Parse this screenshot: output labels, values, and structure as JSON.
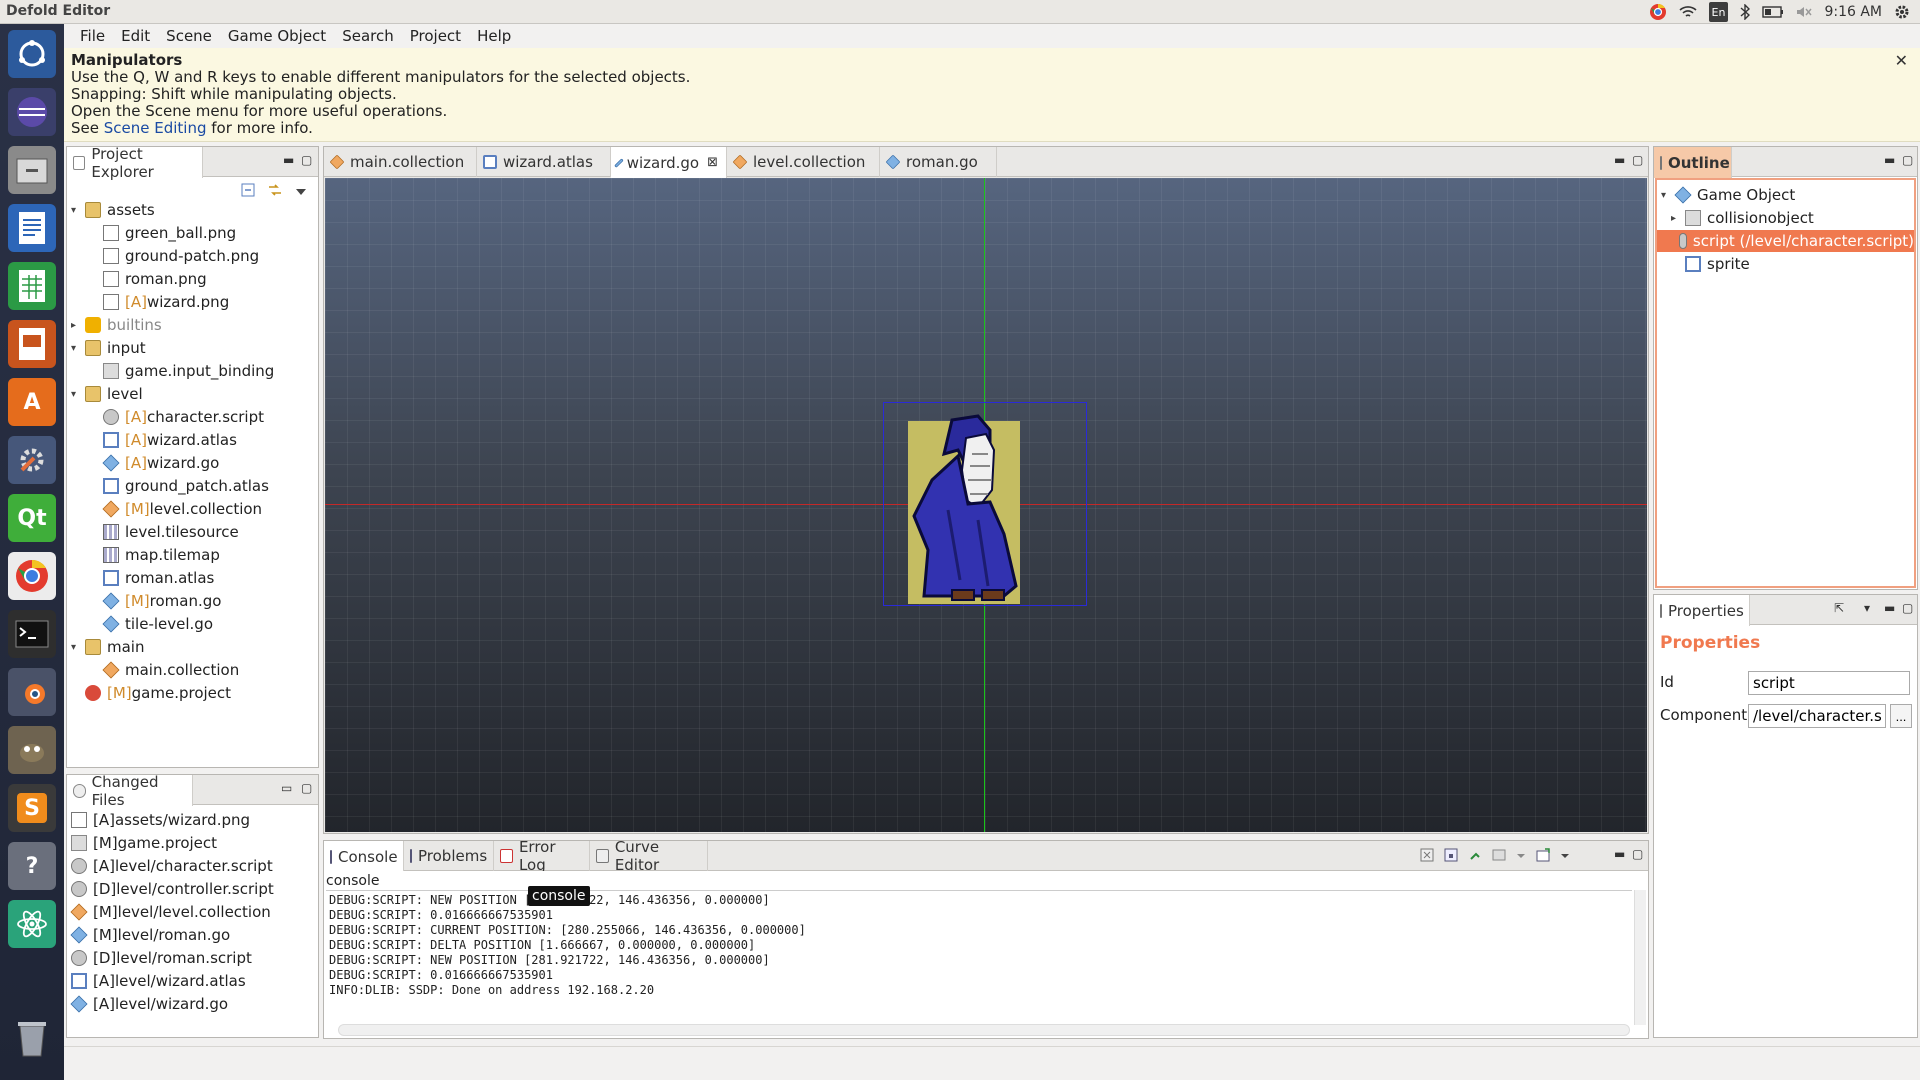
{
  "window": {
    "title": "Defold Editor"
  },
  "system_tray": {
    "language": "En",
    "time": "9:16 AM"
  },
  "menu": [
    "File",
    "Edit",
    "Scene",
    "Game Object",
    "Search",
    "Project",
    "Help"
  ],
  "banner": {
    "title": "Manipulators",
    "lines": [
      "Use the Q, W and R keys to enable different manipulators for the selected objects.",
      "Snapping: Shift while manipulating objects.",
      "Open the Scene menu for more useful operations."
    ],
    "see_prefix": "See ",
    "see_link": "Scene Editing",
    "see_suffix": " for more info.",
    "close": "✕"
  },
  "project_explorer": {
    "tab": "Project Explorer",
    "tree": [
      {
        "prefix": "",
        "name": "assets",
        "type": "folder",
        "depth": 0,
        "expanded": true
      },
      {
        "prefix": "",
        "name": "green_ball.png",
        "type": "png",
        "depth": 1
      },
      {
        "prefix": "",
        "name": "ground-patch.png",
        "type": "png",
        "depth": 1
      },
      {
        "prefix": "",
        "name": "roman.png",
        "type": "png",
        "depth": 1
      },
      {
        "prefix": "[A]",
        "name": "wizard.png",
        "type": "png",
        "depth": 1
      },
      {
        "prefix": "",
        "name": "builtins",
        "type": "builtin",
        "depth": 0,
        "expanded": false
      },
      {
        "prefix": "",
        "name": "input",
        "type": "folder",
        "depth": 0,
        "expanded": true
      },
      {
        "prefix": "",
        "name": "game.input_binding",
        "type": "input",
        "depth": 1
      },
      {
        "prefix": "",
        "name": "level",
        "type": "folder",
        "depth": 0,
        "expanded": true
      },
      {
        "prefix": "[A]",
        "name": "character.script",
        "type": "script",
        "depth": 1
      },
      {
        "prefix": "[A]",
        "name": "wizard.atlas",
        "type": "atlas",
        "depth": 1
      },
      {
        "prefix": "[A]",
        "name": "wizard.go",
        "type": "go",
        "depth": 1
      },
      {
        "prefix": "",
        "name": "ground_patch.atlas",
        "type": "atlas",
        "depth": 1
      },
      {
        "prefix": "[M]",
        "name": "level.collection",
        "type": "coll",
        "depth": 1
      },
      {
        "prefix": "",
        "name": "level.tilesource",
        "type": "tile",
        "depth": 1
      },
      {
        "prefix": "",
        "name": "map.tilemap",
        "type": "tile",
        "depth": 1
      },
      {
        "prefix": "",
        "name": "roman.atlas",
        "type": "atlas",
        "depth": 1
      },
      {
        "prefix": "[M]",
        "name": "roman.go",
        "type": "go",
        "depth": 1
      },
      {
        "prefix": "",
        "name": "tile-level.go",
        "type": "go",
        "depth": 1
      },
      {
        "prefix": "",
        "name": "main",
        "type": "folder",
        "depth": 0,
        "expanded": true
      },
      {
        "prefix": "",
        "name": "main.collection",
        "type": "coll",
        "depth": 1
      },
      {
        "prefix": "[M]",
        "name": "game.project",
        "type": "proj",
        "depth": 0
      }
    ]
  },
  "changed_files": {
    "tab": "Changed Files",
    "items": [
      {
        "text": "[A]assets/wizard.png",
        "type": "png"
      },
      {
        "text": "[M]game.project",
        "type": "input"
      },
      {
        "text": "[A]level/character.script",
        "type": "script"
      },
      {
        "text": "[D]level/controller.script",
        "type": "script"
      },
      {
        "text": "[M]level/level.collection",
        "type": "coll"
      },
      {
        "text": "[M]level/roman.go",
        "type": "go"
      },
      {
        "text": "[D]level/roman.script",
        "type": "script"
      },
      {
        "text": "[A]level/wizard.atlas",
        "type": "atlas"
      },
      {
        "text": "[A]level/wizard.go",
        "type": "go"
      }
    ]
  },
  "editor_tabs": [
    {
      "label": "main.collection",
      "type": "coll",
      "active": false
    },
    {
      "label": "wizard.atlas",
      "type": "atlas",
      "active": false
    },
    {
      "label": "wizard.go",
      "type": "go",
      "active": true,
      "close": "⊠"
    },
    {
      "label": "level.collection",
      "type": "coll",
      "active": false
    },
    {
      "label": "roman.go",
      "type": "go",
      "active": false
    }
  ],
  "console": {
    "tabs": [
      "Console",
      "Problems",
      "Error Log",
      "Curve Editor"
    ],
    "label": "console",
    "tooltip": "console",
    "lines": [
      "DEBUG:SCRIPT: NEW POSITION [281.921722, 146.436356, 0.000000]",
      "DEBUG:SCRIPT: 0.016666667535901",
      "DEBUG:SCRIPT: CURRENT POSITION: [280.255066, 146.436356, 0.000000]",
      "DEBUG:SCRIPT: DELTA POSITION [1.666667, 0.000000, 0.000000]",
      "DEBUG:SCRIPT: NEW POSITION [281.921722, 146.436356, 0.000000]",
      "DEBUG:SCRIPT: 0.016666667535901",
      "INFO:DLIB: SSDP: Done on address 192.168.2.20"
    ]
  },
  "outline": {
    "tab": "Outline",
    "items": [
      {
        "label": "Game Object",
        "type": "go",
        "depth": 0,
        "twisty": "▾"
      },
      {
        "label": "collisionobject",
        "type": "input",
        "depth": 1,
        "twisty": "▸"
      },
      {
        "label": "script (/level/character.script)",
        "type": "script",
        "depth": 1,
        "twisty": "",
        "selected": true
      },
      {
        "label": "sprite",
        "type": "atlas",
        "depth": 1,
        "twisty": ""
      }
    ]
  },
  "properties": {
    "tab": "Properties",
    "heading": "Properties",
    "id_label": "Id",
    "id_value": "script",
    "component_label": "Component",
    "component_value": "/level/character.script",
    "browse": "..."
  },
  "colors": {
    "accent_selection": "#f0794f",
    "axis_x": "#c42828",
    "axis_y": "#19c419",
    "selection_box": "#2a2ad8"
  }
}
